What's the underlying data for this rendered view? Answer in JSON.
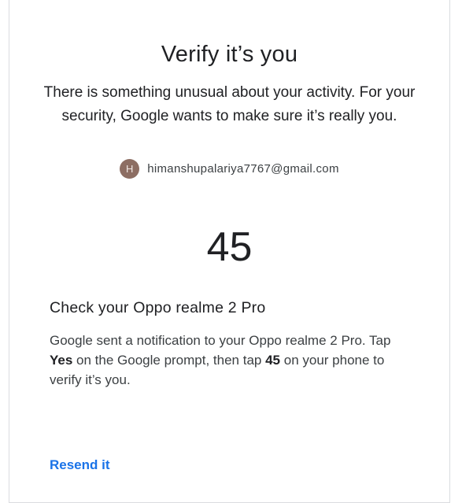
{
  "title": "Verify it’s you",
  "subtitle": "There is something unusual about your activity. For your security, Google wants to make sure it’s really you.",
  "account": {
    "avatar_initial": "H",
    "email": "himanshupalariya7767@gmail.com",
    "avatar_color": "#8d6e63"
  },
  "code": "45",
  "device": {
    "heading": "Check your Oppo realme 2 Pro",
    "instructions": {
      "part1": "Google sent a notification to your Oppo realme 2 Pro. Tap ",
      "yes": "Yes",
      "part2": " on the Google prompt, then tap ",
      "number": "45",
      "part3": " on your phone to verify it’s you."
    }
  },
  "resend_label": "Resend it",
  "colors": {
    "link": "#1a73e8",
    "text": "#202124",
    "border": "#dadce0"
  }
}
